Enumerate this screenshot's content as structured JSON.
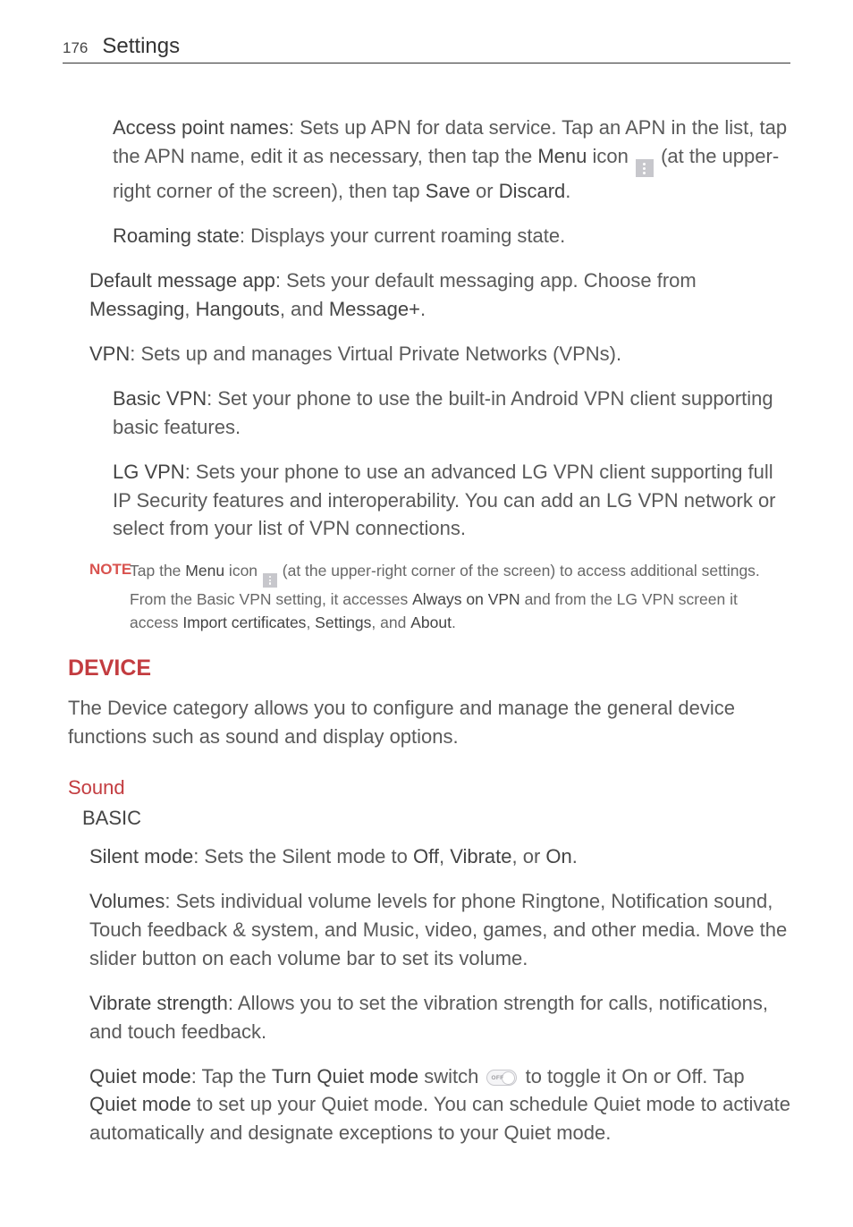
{
  "page_number": "176",
  "header_title": "Settings",
  "p_apn_1": "Access point names",
  "p_apn_2": ": Sets up APN for data service. Tap an APN in the list, tap the APN name, edit it as necessary, then tap the ",
  "p_apn_3": "Menu",
  "p_apn_4": " icon ",
  "p_apn_5": " (at the upper-right corner of the screen), then tap ",
  "p_apn_6": "Save",
  "p_apn_7": " or ",
  "p_apn_8": "Discard",
  "p_apn_9": ".",
  "p_roam_1": "Roaming state",
  "p_roam_2": ": Displays your current roaming state.",
  "p_msg_1": "Default message app",
  "p_msg_2": ": Sets your default messaging app. Choose from ",
  "p_msg_3": "Messaging",
  "p_msg_3b": ", ",
  "p_msg_4": "Hangouts",
  "p_msg_4b": ", and ",
  "p_msg_5": "Message+",
  "p_msg_6": ".",
  "p_vpn_1": "VPN",
  "p_vpn_2": ": Sets up and manages Virtual Private Networks (VPNs).",
  "p_bvpn_1": "Basic VPN",
  "p_bvpn_2": ": Set your phone to use the built-in Android VPN client supporting basic features.",
  "p_lgvpn_1": "LG VPN",
  "p_lgvpn_2": ": Sets your phone to use an advanced LG VPN client supporting full IP Security features and interoperability. You can add an LG VPN network or select from your list of VPN connections.",
  "note_label": "NOTE",
  "note_1": "Tap the ",
  "note_2": "Menu",
  "note_3": " icon ",
  "note_4": " (at the upper-right corner of the screen) to access additional settings. From the Basic VPN setting, it accesses ",
  "note_5": "Always on VPN",
  "note_6": " and from the LG VPN screen it access ",
  "note_7": "Import certificates",
  "note_8": ", ",
  "note_9": "Settings",
  "note_10": ", and ",
  "note_11": "About",
  "note_12": ".",
  "h_device": "DEVICE",
  "device_desc": "The Device category allows you to configure and manage the general device functions such as sound and display options.",
  "h_sound": "Sound",
  "h_basic": "BASIC",
  "p_silent_1": "Silent mode",
  "p_silent_2": ": Sets the Silent mode to ",
  "p_silent_3": "Off",
  "p_silent_3b": ", ",
  "p_silent_4": "Vibrate",
  "p_silent_4b": ", or ",
  "p_silent_5": "On",
  "p_silent_6": ".",
  "p_vol_1": "Volumes",
  "p_vol_2": ": Sets individual volume levels for phone Ringtone, Notification sound, Touch feedback & system, and Music, video, games, and other media. Move the slider button on each volume bar to set its volume.",
  "p_vib_1": "Vibrate strength",
  "p_vib_2": ": Allows you to set the vibration strength for calls, notifications, and touch feedback.",
  "p_q_1": "Quiet mode",
  "p_q_2": ": Tap the ",
  "p_q_3": "Turn Quiet mode",
  "p_q_4": " switch ",
  "p_q_5": " to toggle it On or Off. Tap ",
  "p_q_6": "Quiet mode",
  "p_q_7": " to set up your Quiet mode. You can schedule Quiet mode to activate automatically and designate exceptions to your Quiet mode.",
  "toggle_label": "OFF"
}
